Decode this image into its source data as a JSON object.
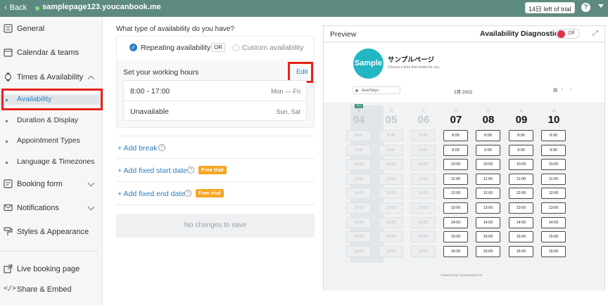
{
  "topbar": {
    "back_label": "Back",
    "url": "samplepage123.youcanbook.me",
    "trial": "14日 left of trial",
    "help": "?"
  },
  "sidebar": {
    "general": "General",
    "calendar": "Calendar & teams",
    "times": "Times & Availability",
    "sub": [
      "Availability",
      "Duration & Display",
      "Appointment Types",
      "Language & Timezones"
    ],
    "booking": "Booking form",
    "notifications": "Notifications",
    "styles": "Styles & Appearance",
    "live": "Live booking page",
    "share": "Share & Embed"
  },
  "main": {
    "question": "What type of availability do you have?",
    "repeating": "Repeating availability",
    "or": "OR",
    "custom": "Custom availability",
    "working_hours_title": "Set your working hours",
    "edit": "Edit",
    "hours": [
      {
        "left": "8:00 - 17:00",
        "right": "Mon — Fri"
      },
      {
        "left": "Unavailable",
        "right": "Sun, Sat"
      }
    ],
    "add_break": "+ Add break",
    "add_fixed_start": "+ Add fixed start date",
    "add_fixed_end": "+ Add fixed end date",
    "free_trial": "Free trial",
    "save": "No changes to save"
  },
  "preview": {
    "title": "Preview",
    "diag": "Availability Diagnostics",
    "toggle": "Off",
    "logo": "Sample",
    "page_title": "サンプルページ",
    "page_sub": "Choose a time that works for you.",
    "timezone": "Asia/Tokyo",
    "month": "2月 2022",
    "today_tag": "今日",
    "days": [
      {
        "dow": "日",
        "num": "04"
      },
      {
        "dow": "月",
        "num": "05"
      },
      {
        "dow": "火",
        "num": "06"
      },
      {
        "dow": "月",
        "num": "07"
      },
      {
        "dow": "火",
        "num": "08"
      },
      {
        "dow": "水",
        "num": "09"
      },
      {
        "dow": "木",
        "num": "10"
      }
    ],
    "times": [
      "8:00",
      "9:00",
      "10:00",
      "11:00",
      "12:00",
      "13:00",
      "14:00",
      "15:00",
      "16:00"
    ],
    "footer": "Powered by YouCanBook.me"
  },
  "colors": {
    "topbar": "#5d8a80",
    "accent": "#2a7fbf",
    "badge": "#f5a623",
    "highlight": "#e8211c",
    "logo": "#22b7c2"
  }
}
